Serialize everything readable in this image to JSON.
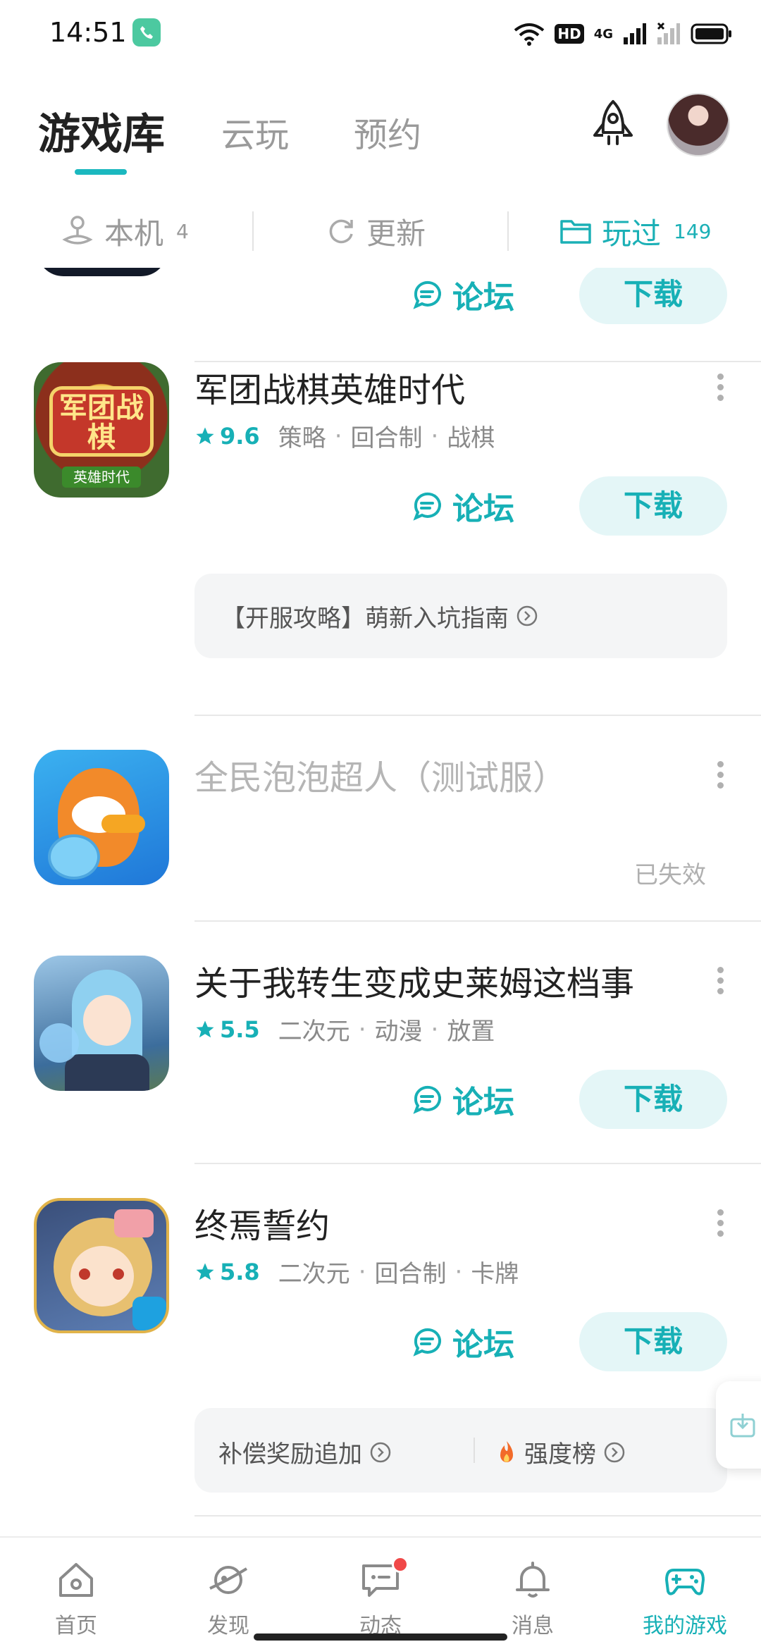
{
  "status_bar": {
    "time": "14:51",
    "hd_label": "HD",
    "network_label": "4G",
    "icons": [
      "phone-call-icon",
      "wifi-icon",
      "hd-icon",
      "signal-icon",
      "signal-2-icon",
      "battery-icon"
    ]
  },
  "top_tabs": {
    "active": "游戏库",
    "cloud": "云玩",
    "reserve": "预约"
  },
  "filters": {
    "local": {
      "label": "本机",
      "count": "4"
    },
    "update": {
      "label": "更新"
    },
    "played": {
      "label": "玩过",
      "count": "149"
    }
  },
  "list": {
    "partial": {
      "forum": "论坛",
      "download": "下载"
    },
    "items": [
      {
        "title": "军团战棋英雄时代",
        "score": "9.6",
        "tags": [
          "策略",
          "回合制",
          "战棋"
        ],
        "forum": "论坛",
        "download": "下载",
        "guide": "【开服攻略】萌新入坑指南",
        "icon_text": "军团战棋",
        "icon_sub": "英雄时代"
      },
      {
        "title": "全民泡泡超人（测试服）",
        "status": "已失效"
      },
      {
        "title": "关于我转生变成史莱姆这档事",
        "score": "5.5",
        "tags": [
          "二次元",
          "动漫",
          "放置"
        ],
        "forum": "论坛",
        "download": "下载"
      },
      {
        "title": "终焉誓约",
        "score": "5.8",
        "tags": [
          "二次元",
          "回合制",
          "卡牌"
        ],
        "forum": "论坛",
        "download": "下载",
        "extras": [
          "补偿奖励追加",
          "强度榜"
        ]
      }
    ]
  },
  "bottom_nav": [
    {
      "label": "首页",
      "icon": "home-icon"
    },
    {
      "label": "发现",
      "icon": "planet-icon"
    },
    {
      "label": "动态",
      "icon": "chat-icon"
    },
    {
      "label": "消息",
      "icon": "bell-icon"
    },
    {
      "label": "我的游戏",
      "icon": "gamepad-icon"
    }
  ],
  "colors": {
    "accent": "#17b0b6",
    "download_bg": "#e4f6f7",
    "badge": "#f04848"
  }
}
